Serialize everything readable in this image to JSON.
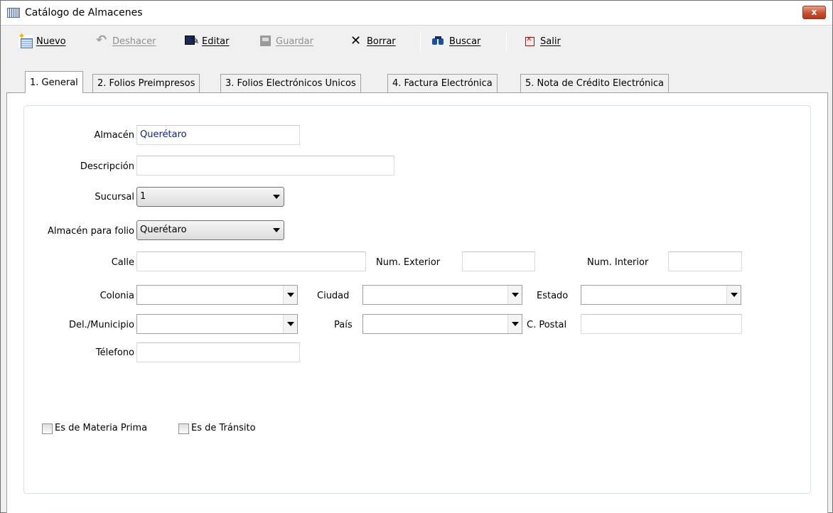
{
  "window": {
    "title": "Catálogo de Almacenes",
    "close_label": "x"
  },
  "toolbar": {
    "nuevo": "Nuevo",
    "deshacer": "Deshacer",
    "editar": "Editar",
    "guardar": "Guardar",
    "borrar": "Borrar",
    "buscar": "Buscar",
    "salir": "Salir"
  },
  "icons": {
    "nuevo": "new-document-icon",
    "deshacer": "undo-icon",
    "editar": "edit-icon",
    "guardar": "save-icon",
    "borrar": "delete-icon",
    "buscar": "binoculars-icon",
    "salir": "exit-icon"
  },
  "tabs": [
    {
      "label": "1. General",
      "active": true
    },
    {
      "label": "2. Folios Preimpresos",
      "active": false
    },
    {
      "label": "3. Folios Electrónicos Unicos",
      "active": false
    },
    {
      "label": "4. Factura Electrónica",
      "active": false
    },
    {
      "label": "5. Nota de Crédito Electrónica",
      "active": false
    }
  ],
  "form": {
    "almacen": {
      "label": "Almacén",
      "value": "Querétaro"
    },
    "descripcion": {
      "label": "Descripción",
      "value": ""
    },
    "sucursal": {
      "label": "Sucursal",
      "value": "1"
    },
    "almacen_folio": {
      "label": "Almacén para folio",
      "value": "Querétaro"
    },
    "calle": {
      "label": "Calle",
      "value": ""
    },
    "num_exterior": {
      "label": "Num. Exterior",
      "value": ""
    },
    "num_interior": {
      "label": "Num. Interior",
      "value": ""
    },
    "colonia": {
      "label": "Colonia",
      "value": ""
    },
    "ciudad": {
      "label": "Ciudad",
      "value": ""
    },
    "estado": {
      "label": "Estado",
      "value": ""
    },
    "municipio": {
      "label": "Del./Municipio",
      "value": ""
    },
    "pais": {
      "label": "País",
      "value": ""
    },
    "cpostal": {
      "label": "C. Postal",
      "value": ""
    },
    "telefono": {
      "label": "Télefono",
      "value": ""
    },
    "materia_prima": {
      "label": "Es de Materia Prima",
      "checked": false
    },
    "transito": {
      "label": "Es de Tránsito",
      "checked": false
    }
  },
  "colors": {
    "field_text": "#10208a",
    "close_button": "#c7502e",
    "window_bg": "#f0f0f0"
  }
}
